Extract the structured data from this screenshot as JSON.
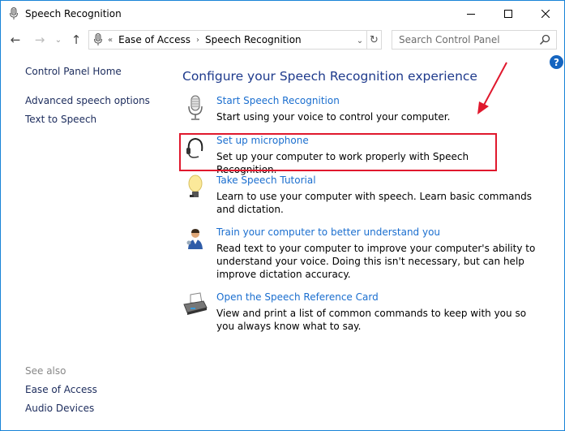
{
  "window": {
    "title": "Speech Recognition",
    "controls": {
      "minimize": "—",
      "maximize": "☐",
      "close": "✕"
    }
  },
  "nav": {
    "back_icon": "←",
    "forward_icon": "→",
    "recent_icon": "⌄",
    "up_icon": "↑",
    "breadcrumb": {
      "overflow": "«",
      "separator": "›",
      "items": [
        "Ease of Access",
        "Speech Recognition"
      ]
    },
    "dropdown_icon": "⌄",
    "refresh_icon": "↻",
    "search": {
      "placeholder": "Search Control Panel",
      "value": ""
    }
  },
  "help": {
    "label": "?"
  },
  "sidebar": {
    "home": "Control Panel Home",
    "links": [
      "Advanced speech options",
      "Text to Speech"
    ],
    "see_also_label": "See also",
    "see_also": [
      "Ease of Access",
      "Audio Devices"
    ]
  },
  "main": {
    "title": "Configure your Speech Recognition experience",
    "tasks": [
      {
        "icon": "microphone-icon",
        "link": "Start Speech Recognition",
        "desc": "Start using your voice to control your computer."
      },
      {
        "icon": "headset-icon",
        "link": "Set up microphone",
        "desc": "Set up your computer to work properly with Speech Recognition."
      },
      {
        "icon": "lightbulb-icon",
        "link": "Take Speech Tutorial",
        "desc": "Learn to use your computer with speech.  Learn basic commands and dictation."
      },
      {
        "icon": "user-headset-icon",
        "link": "Train your computer to better understand you",
        "desc": "Read text to your computer to improve your computer's ability to understand your voice.  Doing this isn't necessary, but can help improve dictation accuracy."
      },
      {
        "icon": "printer-icon",
        "link": "Open the Speech Reference Card",
        "desc": "View and print a list of common commands to keep with you so you always know what to say."
      }
    ]
  },
  "annotation": {
    "highlight_color": "#e0182d",
    "highlighted_task": "Set up microphone"
  }
}
